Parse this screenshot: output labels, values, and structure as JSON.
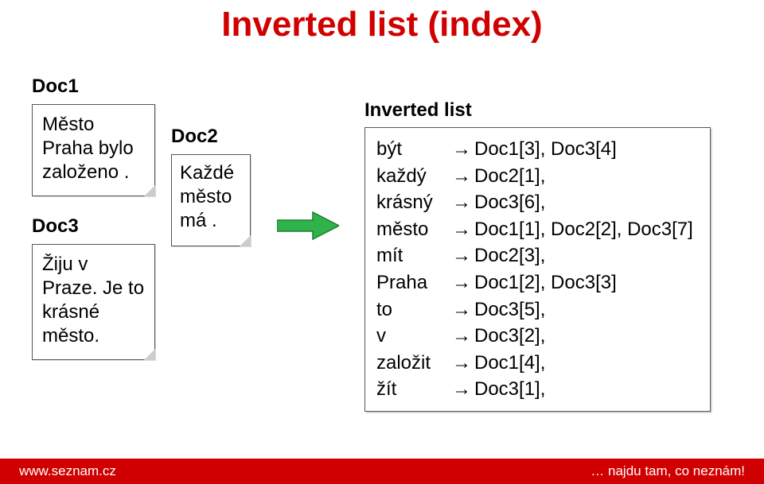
{
  "title": "Inverted list (index)",
  "doc1": {
    "label": "Doc1",
    "text": "Město Praha bylo založeno ."
  },
  "doc3": {
    "label": "Doc3",
    "text": "Žiju v Praze. Je to krásné město."
  },
  "doc2": {
    "label": "Doc2",
    "text": "Každé město má ."
  },
  "inverted": {
    "label": "Inverted list",
    "rows": [
      {
        "term": "být",
        "postings": "Doc1[3], Doc3[4]"
      },
      {
        "term": "každý",
        "postings": "Doc2[1],"
      },
      {
        "term": "krásný",
        "postings": "Doc3[6],"
      },
      {
        "term": "město",
        "postings": "Doc1[1], Doc2[2], Doc3[7]"
      },
      {
        "term": "mít",
        "postings": "Doc2[3],"
      },
      {
        "term": "Praha",
        "postings": "Doc1[2], Doc3[3]"
      },
      {
        "term": "to",
        "postings": "Doc3[5],"
      },
      {
        "term": "v",
        "postings": "Doc3[2],"
      },
      {
        "term": "založit",
        "postings": "Doc1[4],"
      },
      {
        "term": "žít",
        "postings": "Doc3[1],"
      }
    ]
  },
  "footer": {
    "left": "www.seznam.cz",
    "right": "… najdu tam, co neznám!"
  }
}
